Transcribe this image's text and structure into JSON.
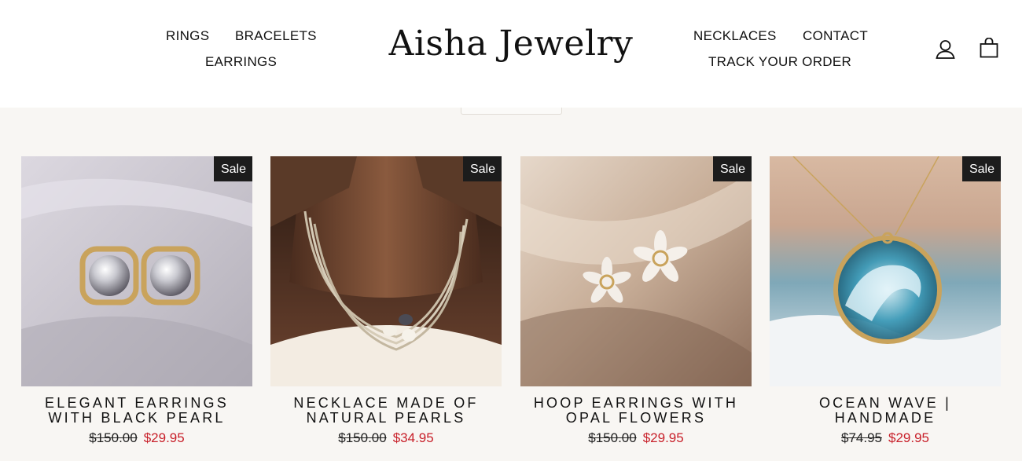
{
  "header": {
    "logo": "Aisha Jewelry",
    "nav_left": [
      "RINGS",
      "BRACELETS",
      "EARRINGS"
    ],
    "nav_right": [
      "NECKLACES",
      "CONTACT",
      "TRACK YOUR ORDER"
    ],
    "icons": [
      "user-icon",
      "cart-icon"
    ]
  },
  "products": [
    {
      "badge": "Sale",
      "title": "ELEGANT EARRINGS WITH BLACK PEARL",
      "old_price": "$150.00",
      "price": "$29.95"
    },
    {
      "badge": "Sale",
      "title": "NECKLACE MADE OF NATURAL PEARLS",
      "old_price": "$150.00",
      "price": "$34.95"
    },
    {
      "badge": "Sale",
      "title": "HOOP EARRINGS WITH OPAL FLOWERS",
      "old_price": "$150.00",
      "price": "$29.95"
    },
    {
      "badge": "Sale",
      "title": "OCEAN WAVE | HANDMADE",
      "old_price": "$74.95",
      "price": "$29.95"
    }
  ],
  "colors": {
    "sale_price": "#c8202a",
    "badge_bg": "#1c1c1c",
    "page_bg": "#f8f6f3"
  }
}
